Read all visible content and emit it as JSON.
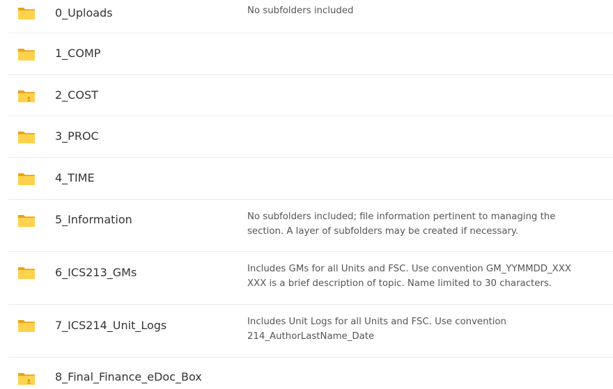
{
  "accent_colors": {
    "folder_back": "#E8A317",
    "folder_front": "#FFD24D",
    "folder_tab": "#F2B632",
    "shared_badge": "#D98A00",
    "divider": "#ECECEC"
  },
  "folders": [
    {
      "name": "0_Uploads",
      "icon": "folder-icon",
      "description": [
        "No subfolders included"
      ]
    },
    {
      "name": "1_COMP",
      "icon": "folder-icon",
      "description": []
    },
    {
      "name": "2_COST",
      "icon": "shared-folder-icon",
      "description": []
    },
    {
      "name": "3_PROC",
      "icon": "folder-icon",
      "description": []
    },
    {
      "name": "4_TIME",
      "icon": "folder-icon",
      "description": []
    },
    {
      "name": "5_Information",
      "icon": "folder-icon",
      "description": [
        "No subfolders included; file information pertinent to managing the",
        "section. A layer of subfolders may be created if necessary."
      ]
    },
    {
      "name": "6_ICS213_GMs",
      "icon": "folder-icon",
      "description": [
        "Includes GMs for all Units and FSC. Use convention GM_YYMMDD_XXX",
        "XXX is a brief description of topic. Name limited to 30 characters."
      ]
    },
    {
      "name": "7_ICS214_Unit_Logs",
      "icon": "folder-icon",
      "description": [
        "Includes Unit Logs for all Units and FSC. Use convention",
        "214_AuthorLastName_Date"
      ]
    },
    {
      "name": "8_Final_Finance_eDoc_Box",
      "icon": "shared-folder-icon",
      "description": []
    }
  ]
}
